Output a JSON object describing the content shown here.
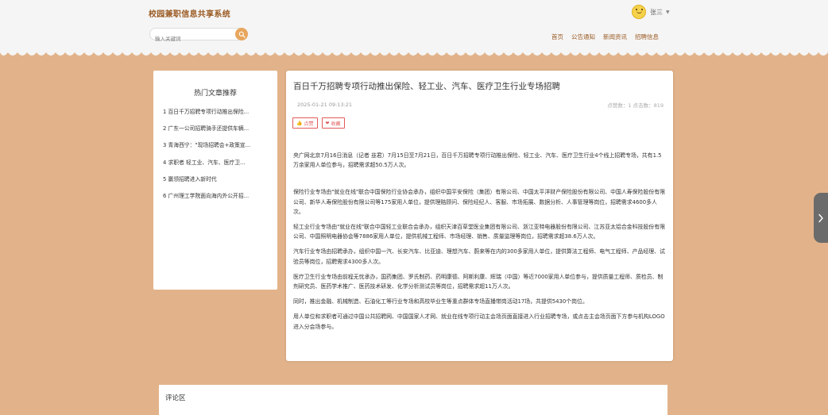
{
  "header": {
    "site_title": "校园兼职信息共享系统",
    "username": "张三",
    "search_placeholder": "输入关键词",
    "nav": [
      "首页",
      "公告通知",
      "新闻资讯",
      "招聘信息"
    ]
  },
  "sidebar": {
    "title": "热门文章推荐",
    "items": [
      "1 百日千万招聘专项行动推出保险...",
      "2 广东一公司招聘骑手还提供车辆...",
      "3 青海西宁：\"现场招聘会+政策宣...",
      "4 求职者 轻工业、汽车、医疗卫...",
      "5 赢领招聘进入新时代",
      "6 广州理工学院面向海内外公开招..."
    ]
  },
  "article": {
    "title": "百日千万招聘专项行动推出保险、轻工业、汽车、医疗卫生行业专场招聘",
    "date": "2025-01-21 09:13:21",
    "stats": "点赞数：1    点击数：819",
    "like_label": "点赞",
    "collect_label": "收藏",
    "paragraphs": [
      "央广网北京7月16日消息（记者 韭君）7月15日至7月21日，百日千万招聘专项行动推出保险、轻工业、汽车、医疗卫生行业4个线上招聘专场，共有1.5万余家用人单位参与，招聘需求超50.5万人次。",
      "保险行业专场由\"就业在线\"联合中国保险行业协会承办，组织中国平安保险（集团）有限公司、中国太平洋财产保险股份有限公司、中国人寿保险股份有限公司、新华人寿保险股份有限公司等175家用人单位，提供理赔顾问、保险经纪人、客服、市场拓展、数据分析、人事管理等岗位，招聘需求4600多人次。",
      "轻工业行业专场由\"就业在线\"联合中国轻工业联合会承办，组织天津百草堂医业集团有限公司、浙江亚特电器股份有限公司、江苏亚太铝合金科技股份有限公司、中国照明电器协会等7886家用人单位，提供机械工程师、市场经理、销售、质量监理等岗位，招聘需求超38.6万人次。",
      "汽车行业专场由招聘承办，组织中国一汽、长安汽车、比亚迪、理想汽车、蔚来等在内的300多家用人单位，提供算法工程师、电气工程师、产品经理、试验员等岗位，招聘需求4300多人次。",
      "医疗卫生行业专场由前程无忧承办，国药集团、罗氏制药、药明康德、阿斯利康、辉瑞（中国）等近7000家用人单位参与，提供质量工程师、质检员、制剂研究员、医药学术推广、医药技术研发、化学分析测试员等岗位，招聘需求超11万人次。",
      "同时，推出金融、机械制造、石油化工等行业专场和高校毕业生等重点群体专场直播带岗活动17场，共提供5430个岗位。",
      "用人单位和求职者可通过中国公共招聘网、中国国家人才网、就业在线专项行动主会场页面直接进入行业招聘专场，或点击主会场页面下方参与机构LOGO进入分会场参与。"
    ]
  },
  "comment": {
    "title": "评论区"
  },
  "colors": {
    "background": "#e2b38a",
    "accent": "#9a5a22",
    "like": "#e25a5a"
  }
}
